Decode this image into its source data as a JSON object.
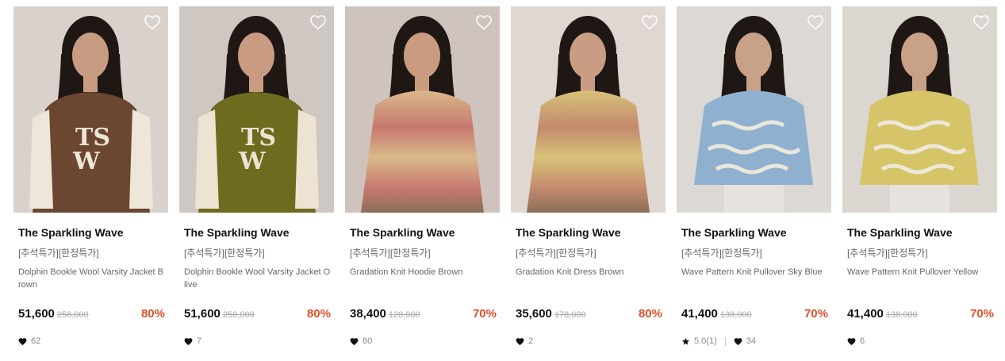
{
  "products": [
    {
      "brand": "The Sparkling Wave",
      "tags": "[추석특가][한정특가]",
      "name": "Dolphin Bookle Wool Varsity Jacket Brown",
      "price": "51,600",
      "original_price": "258,000",
      "discount": "80%",
      "likes": "62",
      "rating": null,
      "colors": {
        "bg": "#d9d2cc",
        "main": "#6b4630",
        "accent": "#eee6d8",
        "skin": "#c89c82",
        "hair": "#1e1714"
      }
    },
    {
      "brand": "The Sparkling Wave",
      "tags": "[추석특가][한정특가]",
      "name": "Dolphin Bookle Wool Varsity Jacket Olive",
      "price": "51,600",
      "original_price": "258,000",
      "discount": "80%",
      "likes": "7",
      "rating": null,
      "colors": {
        "bg": "#cfc7c1",
        "main": "#6e6b1e",
        "accent": "#ece3d2",
        "skin": "#c99b80",
        "hair": "#1e1714"
      }
    },
    {
      "brand": "The Sparkling Wave",
      "tags": "[추석특가][한정특가]",
      "name": "Gradation Knit Hoodie Brown",
      "price": "38,400",
      "original_price": "128,000",
      "discount": "70%",
      "likes": "60",
      "rating": null,
      "colors": {
        "bg": "#cec4bd",
        "main": "#c77870",
        "accent": "#d9b98a",
        "skin": "#c99c80",
        "hair": "#1e1714"
      }
    },
    {
      "brand": "The Sparkling Wave",
      "tags": "[추석특가][한정특가]",
      "name": "Gradation Knit Dress Brown",
      "price": "35,600",
      "original_price": "178,000",
      "discount": "80%",
      "likes": "2",
      "rating": null,
      "colors": {
        "bg": "#dfd7d1",
        "main": "#c48a6e",
        "accent": "#d7c178",
        "skin": "#c99d84",
        "hair": "#1e1714"
      }
    },
    {
      "brand": "The Sparkling Wave",
      "tags": "[추석특가][한정특가]",
      "name": "Wave Pattern Knit Pullover Sky Blue",
      "price": "41,400",
      "original_price": "138,000",
      "discount": "70%",
      "likes": "34",
      "rating": "5.0(1)",
      "colors": {
        "bg": "#dcd8d4",
        "main": "#8fb0cf",
        "accent": "#e9e6dc",
        "skin": "#c9a088",
        "hair": "#1e1714"
      }
    },
    {
      "brand": "The Sparkling Wave",
      "tags": "[추석특가][한정특가]",
      "name": "Wave Pattern Knit Pullover Yellow",
      "price": "41,400",
      "original_price": "138,000",
      "discount": "70%",
      "likes": "6",
      "rating": null,
      "colors": {
        "bg": "#dcd6d1",
        "main": "#d6c468",
        "accent": "#eee8d8",
        "skin": "#c9a088",
        "hair": "#1e1714"
      }
    }
  ]
}
